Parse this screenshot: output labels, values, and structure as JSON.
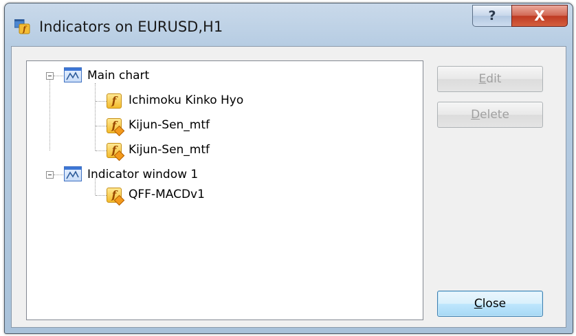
{
  "window": {
    "title": "Indicators on EURUSD,H1",
    "help_label": "?",
    "close_label": "X"
  },
  "tree": {
    "groups": [
      {
        "label": "Main chart",
        "icon": "chart-window-icon",
        "expanded": true,
        "items": [
          {
            "label": "Ichimoku Kinko Hyo",
            "icon": "builtin-indicator-icon"
          },
          {
            "label": "Kijun-Sen_mtf",
            "icon": "custom-indicator-icon"
          },
          {
            "label": "Kijun-Sen_mtf",
            "icon": "custom-indicator-icon"
          }
        ]
      },
      {
        "label": "Indicator window 1",
        "icon": "chart-window-icon",
        "expanded": true,
        "items": [
          {
            "label": "QFF-MACDv1",
            "icon": "custom-indicator-icon"
          }
        ]
      }
    ]
  },
  "buttons": {
    "edit": {
      "mnemonic": "E",
      "rest": "dit",
      "enabled": false
    },
    "delete": {
      "mnemonic": "D",
      "rest": "elete",
      "enabled": false
    },
    "close": {
      "mnemonic": "C",
      "rest": "lose",
      "enabled": true
    }
  },
  "colors": {
    "titlebar": "#b7cde3",
    "close_button": "#c7432b",
    "indicator_icon": "#f3bb2c",
    "window_icon": "#3d77d6"
  }
}
